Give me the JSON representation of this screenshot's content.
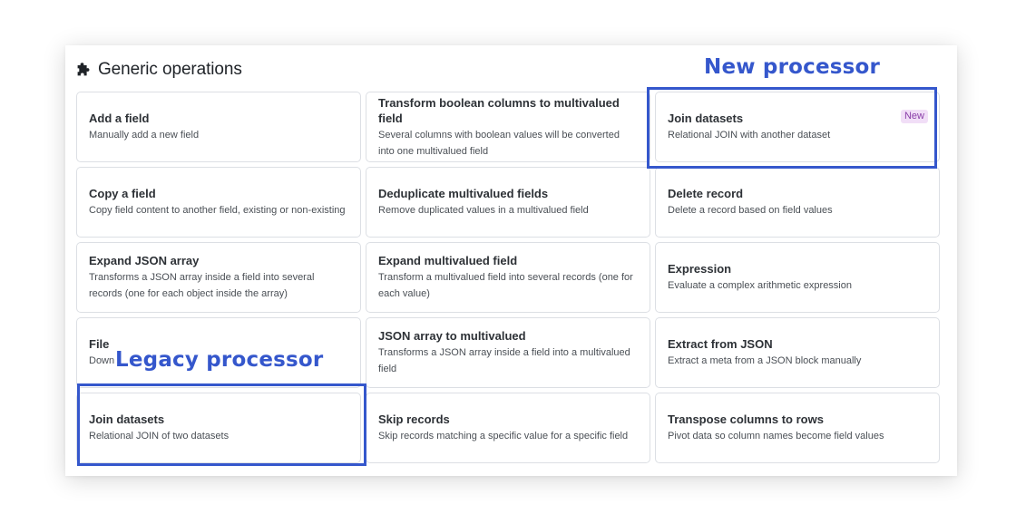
{
  "panel": {
    "title": "Generic operations",
    "title_icon": "puzzle-icon"
  },
  "annotations": {
    "new_label": "New processor",
    "legacy_label": "Legacy processor",
    "color": "#3557cc"
  },
  "cards": [
    {
      "title": "Add a field",
      "desc": "Manually add a new field"
    },
    {
      "title": "Transform boolean columns to multivalued field",
      "desc": "Several columns with boolean values will be converted into one multivalued field"
    },
    {
      "title": "Join datasets",
      "desc": "Relational JOIN with another dataset",
      "badge": "New"
    },
    {
      "title": "Copy a field",
      "desc": "Copy field content to another field, existing or non-existing"
    },
    {
      "title": "Deduplicate multivalued fields",
      "desc": "Remove duplicated values in a multivalued field"
    },
    {
      "title": "Delete record",
      "desc": "Delete a record based on field values"
    },
    {
      "title": "Expand JSON array",
      "desc": "Transforms a JSON array inside a field into several records (one for each object inside the array)"
    },
    {
      "title": "Expand multivalued field",
      "desc": "Transform a multivalued field into several records (one for each value)"
    },
    {
      "title": "Expression",
      "desc": "Evaluate a complex arithmetic expression"
    },
    {
      "title": "File",
      "desc": "Down"
    },
    {
      "title": "JSON array to multivalued",
      "desc": "Transforms a JSON array inside a field into a multivalued field"
    },
    {
      "title": "Extract from JSON",
      "desc": "Extract a meta from a JSON block manually"
    },
    {
      "title": "Join datasets",
      "desc": "Relational JOIN of two datasets"
    },
    {
      "title": "Skip records",
      "desc": "Skip records matching a specific value for a specific field"
    },
    {
      "title": "Transpose columns to rows",
      "desc": "Pivot data so column names become field values"
    }
  ]
}
